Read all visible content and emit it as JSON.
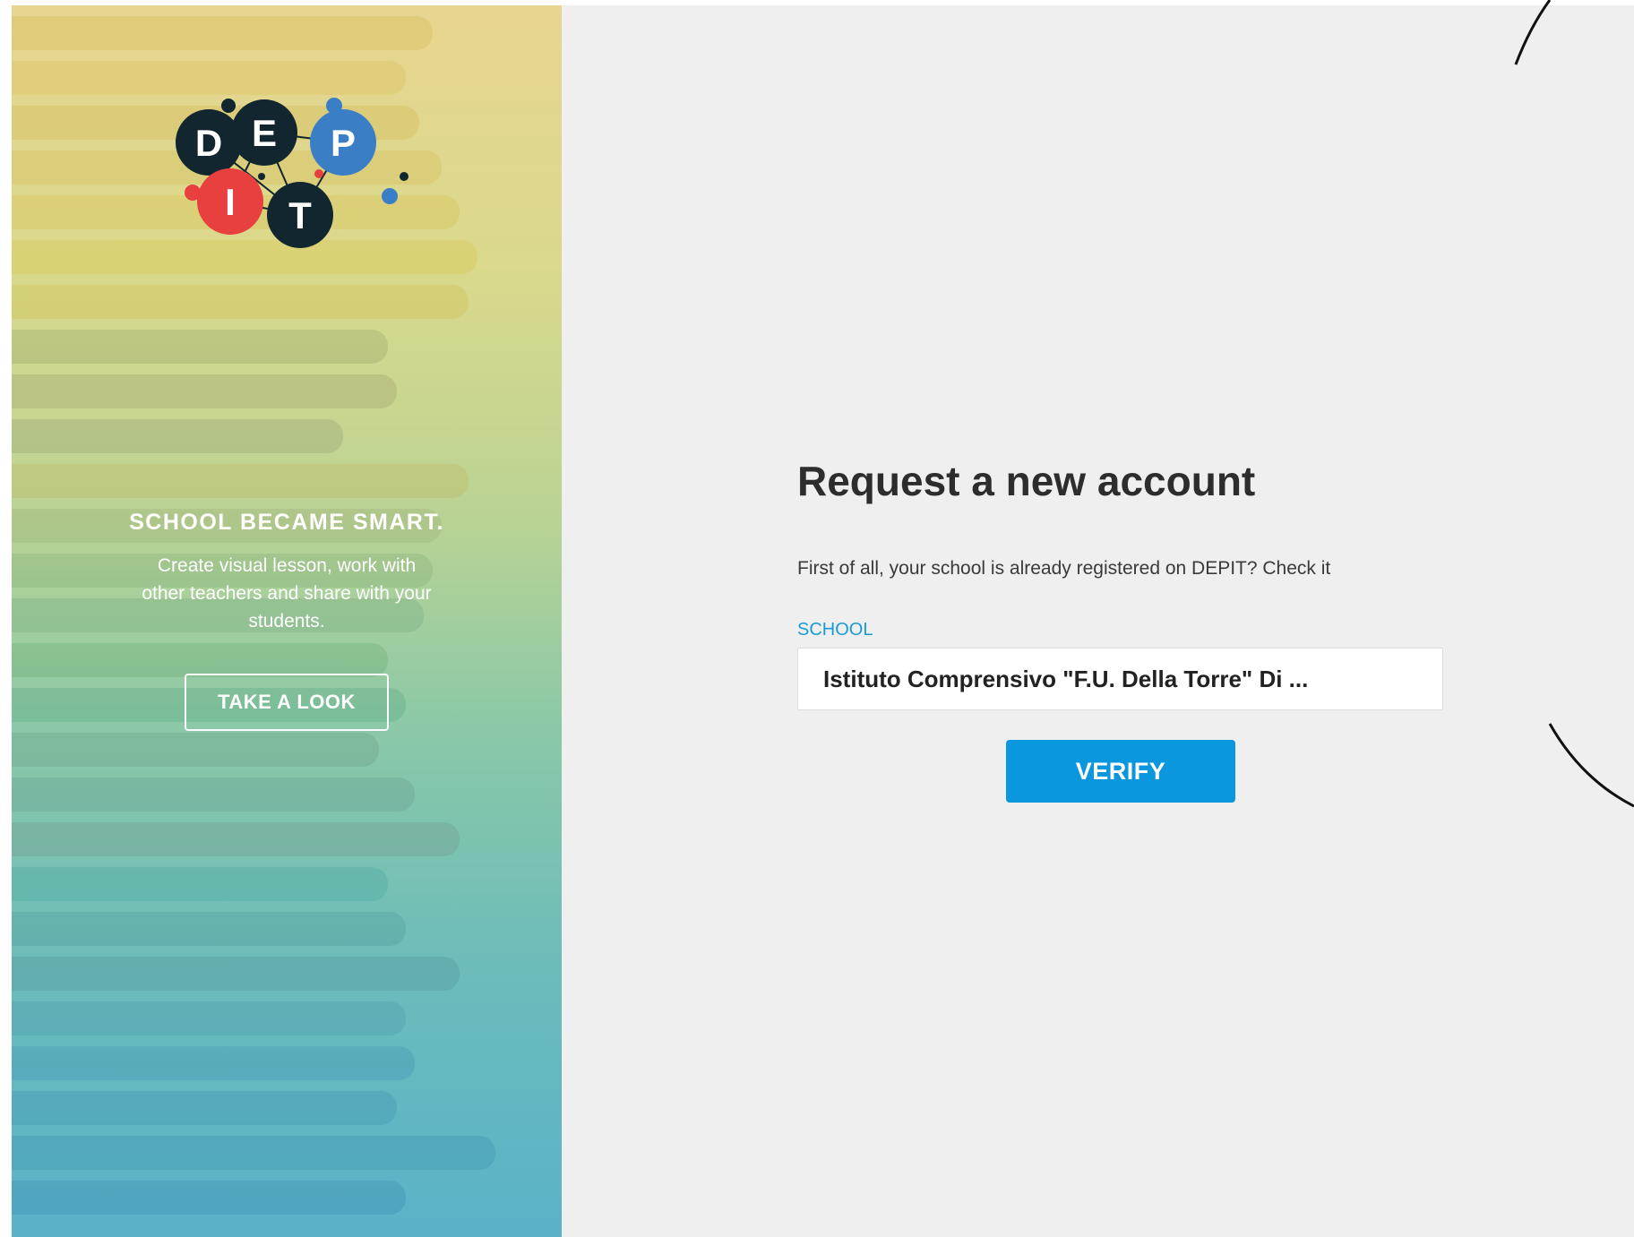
{
  "hero": {
    "logo": {
      "letters": [
        "D",
        "E",
        "P",
        "I",
        "T"
      ],
      "colors": {
        "dark": "#12262f",
        "blue": "#3a7fc6",
        "red": "#e8403f"
      }
    },
    "tagline": "SCHOOL BECAME SMART.",
    "subtext": "Create visual lesson, work with other teachers and share with your students.",
    "cta_label": "TAKE A LOOK"
  },
  "form": {
    "title": "Request a new account",
    "intro": "First of all, your school is already registered on DEPIT? Check it",
    "school_label": "SCHOOL",
    "school_value": "Istituto Comprensivo \"F.U. Della Torre\" Di ...",
    "verify_label": "VERIFY",
    "accent_color": "#0a97de"
  }
}
